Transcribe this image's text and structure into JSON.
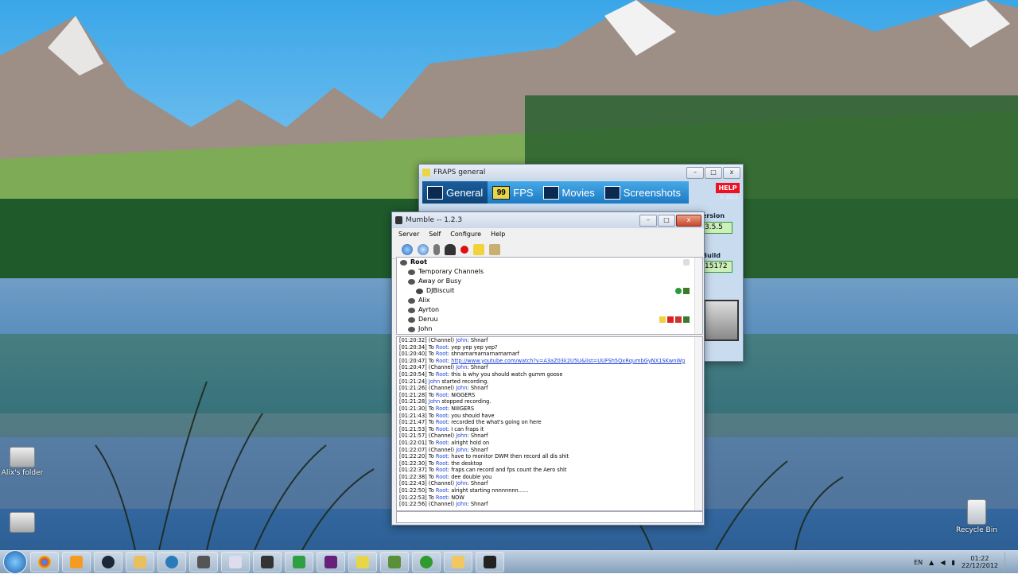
{
  "desktop": {
    "icons": [
      {
        "label": "Alix's folder"
      },
      {
        "label": ""
      },
      {
        "label": "Recycle Bin"
      }
    ]
  },
  "fraps": {
    "title": "FRAPS general",
    "tabs": [
      "General",
      "FPS",
      "Movies",
      "Screenshots"
    ],
    "help_label": "HELP",
    "copyright": "© 2012",
    "version_label": "ersion",
    "version_value": "3.5.5",
    "build_label": "Build",
    "build_value": "15172"
  },
  "mumble": {
    "title": "Mumble -- 1.2.3",
    "menu": [
      "Server",
      "Self",
      "Configure",
      "Help"
    ],
    "tree": [
      {
        "label": "Root",
        "level": 0,
        "type": "channel"
      },
      {
        "label": "Temporary Channels",
        "level": 1,
        "type": "channel"
      },
      {
        "label": "Away or Busy",
        "level": 1,
        "type": "channel"
      },
      {
        "label": "DJBiscuit",
        "level": 2,
        "type": "user"
      },
      {
        "label": "Alix",
        "level": 1,
        "type": "user"
      },
      {
        "label": "Ayrton",
        "level": 1,
        "type": "user"
      },
      {
        "label": "Deruu",
        "level": 1,
        "type": "user"
      },
      {
        "label": "John",
        "level": 1,
        "type": "user"
      }
    ],
    "log": [
      {
        "ts": "[01:20:32]",
        "pre": "(Channel) ",
        "who": "John",
        "msg": ": Shnarf"
      },
      {
        "ts": "[01:20:34]",
        "pre": "To ",
        "who": "Root",
        "msg": ": yep yep yep yep?"
      },
      {
        "ts": "[01:20:40]",
        "pre": "To ",
        "who": "Root",
        "msg": ": shnarnarnarnarnarnarnarf"
      },
      {
        "ts": "[01:20:47]",
        "pre": "To ",
        "who": "Root",
        "link": "http://www.youtube.com/watch?v=A3aZ03k2U5U&list=UUFSh5QxRqumbGyNX1SKwnWg"
      },
      {
        "ts": "[01:20:47]",
        "pre": "(Channel) ",
        "who": "John",
        "msg": ": Shnarf"
      },
      {
        "ts": "[01:20:54]",
        "pre": "To ",
        "who": "Root",
        "msg": ": this is why you should watch gumm goose"
      },
      {
        "ts": "[01:21:24]",
        "pre": "",
        "who": "John",
        "msg": " started recording."
      },
      {
        "ts": "[01:21:26]",
        "pre": "(Channel) ",
        "who": "John",
        "msg": ": Shnarf"
      },
      {
        "ts": "[01:21:28]",
        "pre": "To ",
        "who": "Root",
        "msg": ": NIGGERS"
      },
      {
        "ts": "[01:21:28]",
        "pre": "",
        "who": "John",
        "msg": " stopped recording."
      },
      {
        "ts": "[01:21:30]",
        "pre": "To ",
        "who": "Root",
        "msg": ": NIIIGERS"
      },
      {
        "ts": "[01:21:43]",
        "pre": "To ",
        "who": "Root",
        "msg": ": you should have"
      },
      {
        "ts": "[01:21:47]",
        "pre": "To ",
        "who": "Root",
        "msg": ": recorded the what's going on here"
      },
      {
        "ts": "[01:21:53]",
        "pre": "To ",
        "who": "Root",
        "msg": ": I can fraps it"
      },
      {
        "ts": "[01:21:57]",
        "pre": "(Channel) ",
        "who": "John",
        "msg": ": Shnarf"
      },
      {
        "ts": "[01:22:01]",
        "pre": "To ",
        "who": "Root",
        "msg": ": alright hold on"
      },
      {
        "ts": "[01:22:07]",
        "pre": "(Channel) ",
        "who": "John",
        "msg": ": Shnarf"
      },
      {
        "ts": "[01:22:20]",
        "pre": "To ",
        "who": "Root",
        "msg": ": have to monitor DWM then record all dis shit"
      },
      {
        "ts": "[01:22:30]",
        "pre": "To ",
        "who": "Root",
        "msg": ": the desktop"
      },
      {
        "ts": "[01:22:37]",
        "pre": "To ",
        "who": "Root",
        "msg": ": fraps can record and fps count the Aero shit"
      },
      {
        "ts": "[01:22:38]",
        "pre": "To ",
        "who": "Root",
        "msg": ": dee double you"
      },
      {
        "ts": "[01:22:43]",
        "pre": "(Channel) ",
        "who": "John",
        "msg": ": Shnarf"
      },
      {
        "ts": "[01:22:50]",
        "pre": "To ",
        "who": "Root",
        "msg": ": alright starting nnnnnnnn......"
      },
      {
        "ts": "[01:22:53]",
        "pre": "To ",
        "who": "Root",
        "msg": ": NOW"
      },
      {
        "ts": "[01:22:56]",
        "pre": "(Channel) ",
        "who": "John",
        "msg": ": Shnarf"
      }
    ]
  },
  "taskbar": {
    "language": "EN",
    "time": "01:22",
    "date": "22/12/2012"
  }
}
